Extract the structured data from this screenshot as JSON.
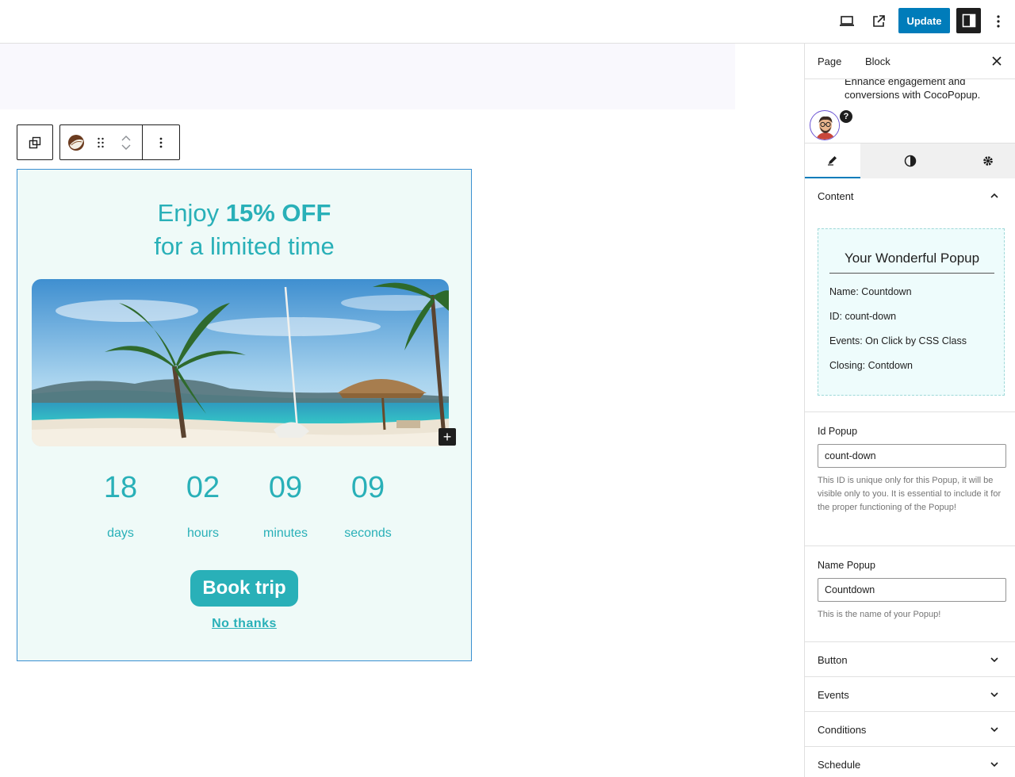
{
  "topbar": {
    "update_label": "Update",
    "icons": [
      "desktop-preview-icon",
      "external-link-icon",
      "sidebar-toggle-icon",
      "more-options-icon"
    ]
  },
  "block_toolbar": {
    "icons": [
      "transform-block-icon",
      "coconut-block-icon",
      "drag-handle-icon",
      "move-up-icon",
      "move-down-icon",
      "more-options-icon"
    ]
  },
  "popup": {
    "headline_prefix": "Enjoy ",
    "headline_bold": "15% OFF",
    "headline_line2": "for a limited time",
    "countdown": [
      {
        "value": "18",
        "label": "days"
      },
      {
        "value": "02",
        "label": "hours"
      },
      {
        "value": "09",
        "label": "minutes"
      },
      {
        "value": "09",
        "label": "seconds"
      }
    ],
    "book_label": "Book trip",
    "no_thanks_label": "No thanks",
    "accent_color": "#29b0b8",
    "background_color": "#effaf8"
  },
  "sidebar": {
    "tabs": [
      "Page",
      "Block"
    ],
    "description": "Enhance engagement and conversions with CocoPopup.",
    "help_glyph": "?",
    "content_section": "Content",
    "preview": {
      "title": "Your Wonderful Popup",
      "name_line": "Name: Countdown",
      "id_line": "ID: count-down",
      "events_line": "Events: On Click by CSS Class",
      "closing_line": "Closing: Contdown"
    },
    "id_field": {
      "label": "Id Popup",
      "value": "count-down",
      "help": "This ID is unique only for this Popup, it will be visible only to you. It is essential to include it for the proper functioning of the Popup!"
    },
    "name_field": {
      "label": "Name Popup",
      "value": "Countdown",
      "help": "This is the name of your Popup!"
    },
    "collapsed_sections": [
      "Button",
      "Events",
      "Conditions",
      "Schedule"
    ]
  }
}
